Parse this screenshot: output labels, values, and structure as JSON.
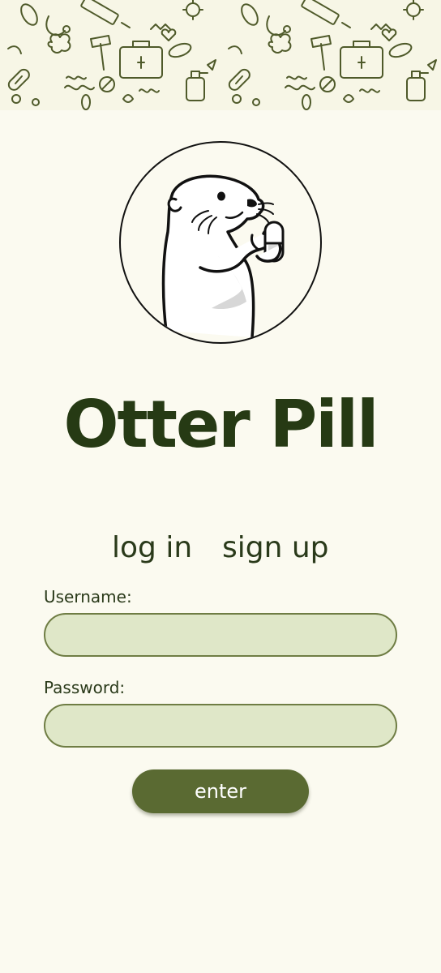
{
  "app": {
    "title": "Otter Pill"
  },
  "auth_tabs": {
    "login_label": "log in",
    "signup_label": "sign up"
  },
  "form": {
    "username_label": "Username:",
    "username_value": "",
    "password_label": "Password:",
    "password_value": "",
    "submit_label": "enter"
  },
  "colors": {
    "background": "#fbfaf0",
    "title_text": "#263a14",
    "input_fill": "#dfe7c8",
    "input_border": "#6f7d44",
    "button_fill": "#5a6a32",
    "doodle_stroke": "#4f5a2a"
  },
  "icons": {
    "banner": "medical-doodle-pattern",
    "logo": "otter-holding-pill-icon"
  }
}
